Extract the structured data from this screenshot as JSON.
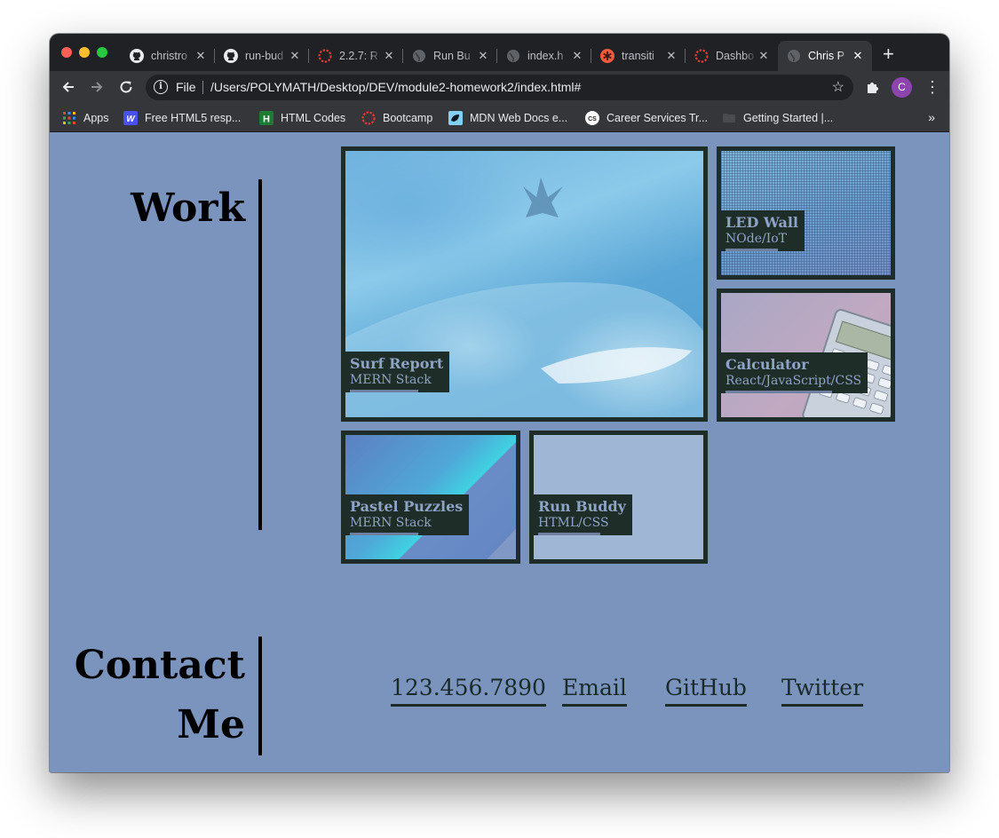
{
  "browser": {
    "tabs": [
      {
        "title": "christro",
        "favicon": "github-icon"
      },
      {
        "title": "run-bud",
        "favicon": "github-icon"
      },
      {
        "title": "2.2.7: R",
        "favicon": "bootcamp-icon"
      },
      {
        "title": "Run Bu",
        "favicon": "globe-icon"
      },
      {
        "title": "index.h",
        "favicon": "globe-icon"
      },
      {
        "title": "transiti",
        "favicon": "asterisk-icon"
      },
      {
        "title": "Dashbo",
        "favicon": "bootcamp-icon"
      },
      {
        "title": "Chris P",
        "favicon": "globe-icon"
      }
    ],
    "new_tab": "+",
    "omnibox": {
      "scheme_label": "File",
      "url": "/Users/POLYMATH/Desktop/DEV/module2-homework2/index.html#"
    },
    "profile_initial": "C",
    "bookmarks": [
      {
        "label": "Apps",
        "icon": "apps-grid-icon"
      },
      {
        "label": "Free HTML5 resp...",
        "icon": "w-icon"
      },
      {
        "label": "HTML Codes",
        "icon": "h-icon"
      },
      {
        "label": "Bootcamp",
        "icon": "bootcamp-icon"
      },
      {
        "label": "MDN Web Docs e...",
        "icon": "mdn-icon"
      },
      {
        "label": "Career Services Tr...",
        "icon": "cs-icon"
      },
      {
        "label": "Getting Started |...",
        "icon": "folder-icon"
      }
    ],
    "bookmarks_more": "»"
  },
  "page": {
    "work_heading": "Work",
    "contact_heading_line1": "Contact",
    "contact_heading_line2": "Me",
    "projects": [
      {
        "title": "Surf Report",
        "stack": "MERN Stack"
      },
      {
        "title": "LED Wall",
        "stack": "NOde/IoT"
      },
      {
        "title": "Calculator",
        "stack": "React/JavaScript/CSS"
      },
      {
        "title": "Pastel Puzzles",
        "stack": "MERN Stack"
      },
      {
        "title": "Run Buddy",
        "stack": "HTML/CSS"
      }
    ],
    "contacts": [
      "123.456.7890",
      "Email",
      "GitHub",
      "Twitter"
    ]
  },
  "colors": {
    "page_bg": "#7a94be",
    "tile_border": "#1f2d28",
    "caption_text": "#8ea4c6",
    "chrome_dark": "#202124",
    "chrome_toolbar": "#35363a"
  }
}
